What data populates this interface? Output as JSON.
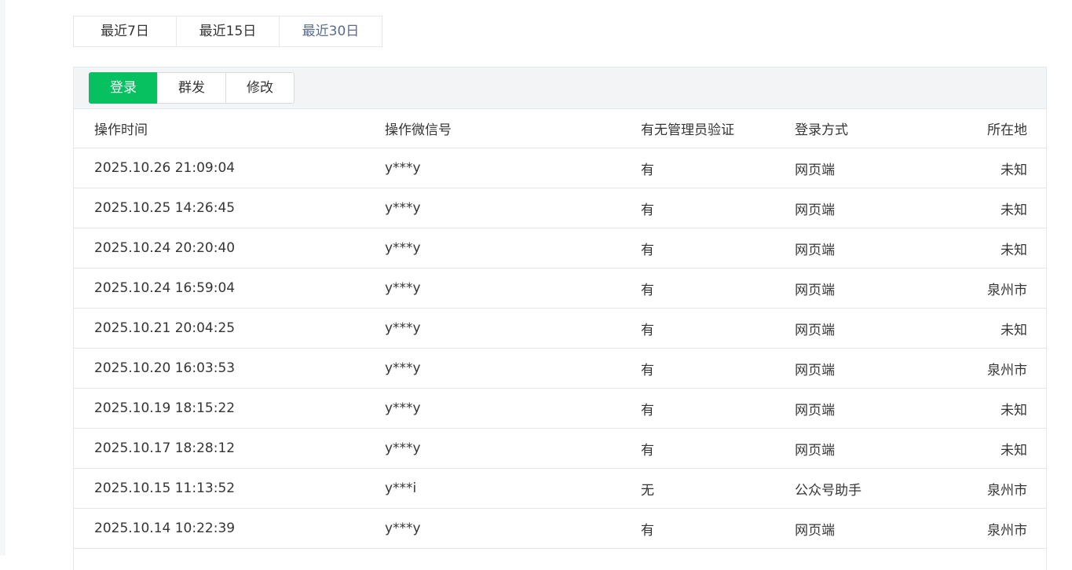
{
  "range_tabs": [
    {
      "label": "最近7日",
      "active": false
    },
    {
      "label": "最近15日",
      "active": false
    },
    {
      "label": "最近30日",
      "active": true
    }
  ],
  "type_tabs": [
    {
      "label": "登录",
      "active": true
    },
    {
      "label": "群发",
      "active": false
    },
    {
      "label": "修改",
      "active": false
    }
  ],
  "table": {
    "columns": [
      "操作时间",
      "操作微信号",
      "有无管理员验证",
      "登录方式",
      "所在地"
    ],
    "rows": [
      {
        "time": "2025.10.26 21:09:04",
        "wechat": "y***y",
        "admin": "有",
        "method": "网页端",
        "location": "未知"
      },
      {
        "time": "2025.10.25 14:26:45",
        "wechat": "y***y",
        "admin": "有",
        "method": "网页端",
        "location": "未知"
      },
      {
        "time": "2025.10.24 20:20:40",
        "wechat": "y***y",
        "admin": "有",
        "method": "网页端",
        "location": "未知"
      },
      {
        "time": "2025.10.24 16:59:04",
        "wechat": "y***y",
        "admin": "有",
        "method": "网页端",
        "location": "泉州市"
      },
      {
        "time": "2025.10.21 20:04:25",
        "wechat": "y***y",
        "admin": "有",
        "method": "网页端",
        "location": "未知"
      },
      {
        "time": "2025.10.20 16:03:53",
        "wechat": "y***y",
        "admin": "有",
        "method": "网页端",
        "location": "泉州市"
      },
      {
        "time": "2025.10.19 18:15:22",
        "wechat": "y***y",
        "admin": "有",
        "method": "网页端",
        "location": "未知"
      },
      {
        "time": "2025.10.17 18:28:12",
        "wechat": "y***y",
        "admin": "有",
        "method": "网页端",
        "location": "未知"
      },
      {
        "time": "2025.10.15 11:13:52",
        "wechat": "y***i",
        "admin": "无",
        "method": "公众号助手",
        "location": "泉州市"
      },
      {
        "time": "2025.10.14 10:22:39",
        "wechat": "y***y",
        "admin": "有",
        "method": "网页端",
        "location": "泉州市"
      }
    ]
  },
  "colors": {
    "accent_green": "#07c160",
    "link_blue": "#576b95",
    "border": "#e4e8eb",
    "header_bg": "#f3f4f6"
  }
}
